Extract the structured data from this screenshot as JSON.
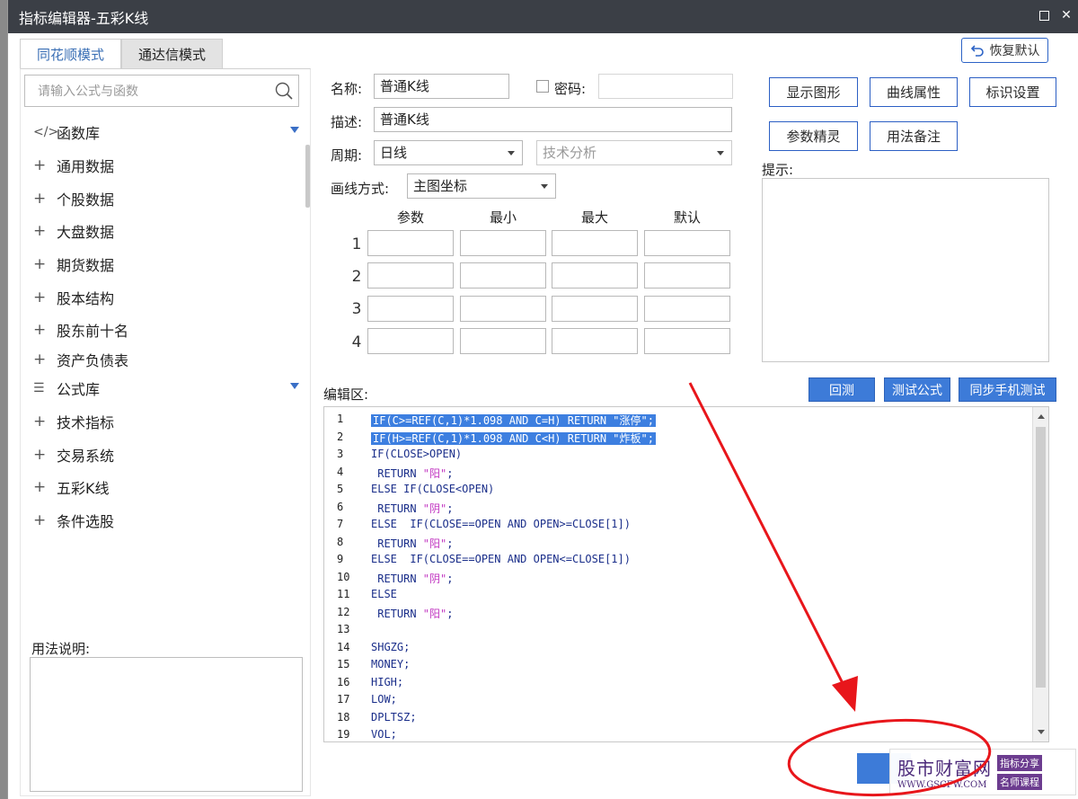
{
  "window": {
    "title": "指标编辑器-五彩K线"
  },
  "tabs": [
    {
      "label": "同花顺模式",
      "active": true
    },
    {
      "label": "通达信模式",
      "active": false
    }
  ],
  "restore_default": "恢复默认",
  "search": {
    "placeholder": "请输入公式与函数"
  },
  "tree": {
    "function_lib": "函数库",
    "function_items": [
      "通用数据",
      "个股数据",
      "大盘数据",
      "期货数据",
      "股本结构",
      "股东前十名",
      "资产负债表"
    ],
    "formula_lib": "公式库",
    "formula_items": [
      "技术指标",
      "交易系统",
      "五彩K线",
      "条件选股"
    ]
  },
  "usage_label": "用法说明:",
  "form": {
    "name_label": "名称:",
    "name_value": "普通K线",
    "password_label": "密码:",
    "desc_label": "描述:",
    "desc_value": "普通K线",
    "period_label": "周期:",
    "period_value": "日线",
    "category_value": "技术分析",
    "draw_label": "画线方式:",
    "draw_value": "主图坐标"
  },
  "param_grid": {
    "headers": [
      "参数",
      "最小",
      "最大",
      "默认"
    ],
    "rows": [
      "1",
      "2",
      "3",
      "4"
    ]
  },
  "right_buttons": {
    "show_graph": "显示图形",
    "curve_props": "曲线属性",
    "mark_settings": "标识设置",
    "param_wizard": "参数精灵",
    "usage_notes": "用法备注"
  },
  "hint_label": "提示:",
  "editor": {
    "label": "编辑区:",
    "backtest": "回测",
    "test_formula": "测试公式",
    "sync_mobile": "同步手机测试",
    "lines": [
      {
        "n": "1",
        "text": "IF(C>=REF(C,1)*1.098 AND C=H) RETURN \"涨停\";",
        "selected": true
      },
      {
        "n": "2",
        "text": "IF(H>=REF(C,1)*1.098 AND C<H) RETURN \"炸板\";",
        "selected": true
      },
      {
        "n": "3",
        "text": "IF(CLOSE>OPEN)"
      },
      {
        "n": "4",
        "text": " RETURN ",
        "str": "\"阳\"",
        "tail": ";"
      },
      {
        "n": "5",
        "text": "ELSE IF(CLOSE<OPEN)"
      },
      {
        "n": "6",
        "text": " RETURN ",
        "str": "\"阴\"",
        "tail": ";"
      },
      {
        "n": "7",
        "text": "ELSE  IF(CLOSE==OPEN AND OPEN>=CLOSE[1])"
      },
      {
        "n": "8",
        "text": " RETURN ",
        "str": "\"阳\"",
        "tail": ";"
      },
      {
        "n": "9",
        "text": "ELSE  IF(CLOSE==OPEN AND OPEN<=CLOSE[1])"
      },
      {
        "n": "10",
        "text": " RETURN ",
        "str": "\"阴\"",
        "tail": ";"
      },
      {
        "n": "11",
        "text": "ELSE"
      },
      {
        "n": "12",
        "text": " RETURN ",
        "str": "\"阳\"",
        "tail": ";"
      },
      {
        "n": "13",
        "text": ""
      },
      {
        "n": "14",
        "text": "SHGZG;"
      },
      {
        "n": "15",
        "text": "MONEY;"
      },
      {
        "n": "16",
        "text": "HIGH;"
      },
      {
        "n": "17",
        "text": "LOW;"
      },
      {
        "n": "18",
        "text": "DPLTSZ;"
      },
      {
        "n": "19",
        "text": "VOL;"
      }
    ]
  },
  "watermark": {
    "title": "股市财富网",
    "url": "WWW.GSCFW.COM",
    "tag1": "指标分享",
    "tag2": "名师课程"
  },
  "colors": {
    "titlebar": "#3b3f46",
    "accent_blue": "#3d7bd8",
    "annotation_red": "#e8161b"
  }
}
